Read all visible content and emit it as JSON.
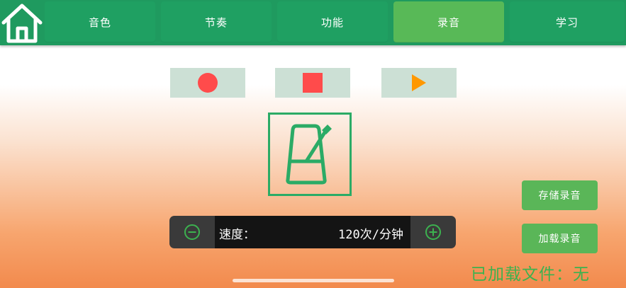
{
  "nav": {
    "home_icon": "home-icon",
    "tabs": [
      {
        "label": "音色",
        "active": false
      },
      {
        "label": "节奏",
        "active": false
      },
      {
        "label": "功能",
        "active": false
      },
      {
        "label": "录音",
        "active": true
      },
      {
        "label": "学习",
        "active": false
      }
    ],
    "bar_color": "#1f9a5f",
    "active_color": "#58b957"
  },
  "controls": {
    "record_icon": "record-icon",
    "stop_icon": "stop-icon",
    "play_icon": "play-icon",
    "record_color": "#ff4b4b",
    "stop_color": "#ff4b4b",
    "play_color": "#ff9800"
  },
  "metronome": {
    "icon": "metronome-icon",
    "color": "#2bab66"
  },
  "speed": {
    "label": "速度：",
    "value": "120次/分钟",
    "minus_icon": "minus-circle-icon",
    "plus_icon": "plus-circle-icon"
  },
  "side_buttons": {
    "save_label": "存储录音",
    "load_label": "加载录音"
  },
  "status": {
    "loaded_file": "已加载文件：无"
  }
}
